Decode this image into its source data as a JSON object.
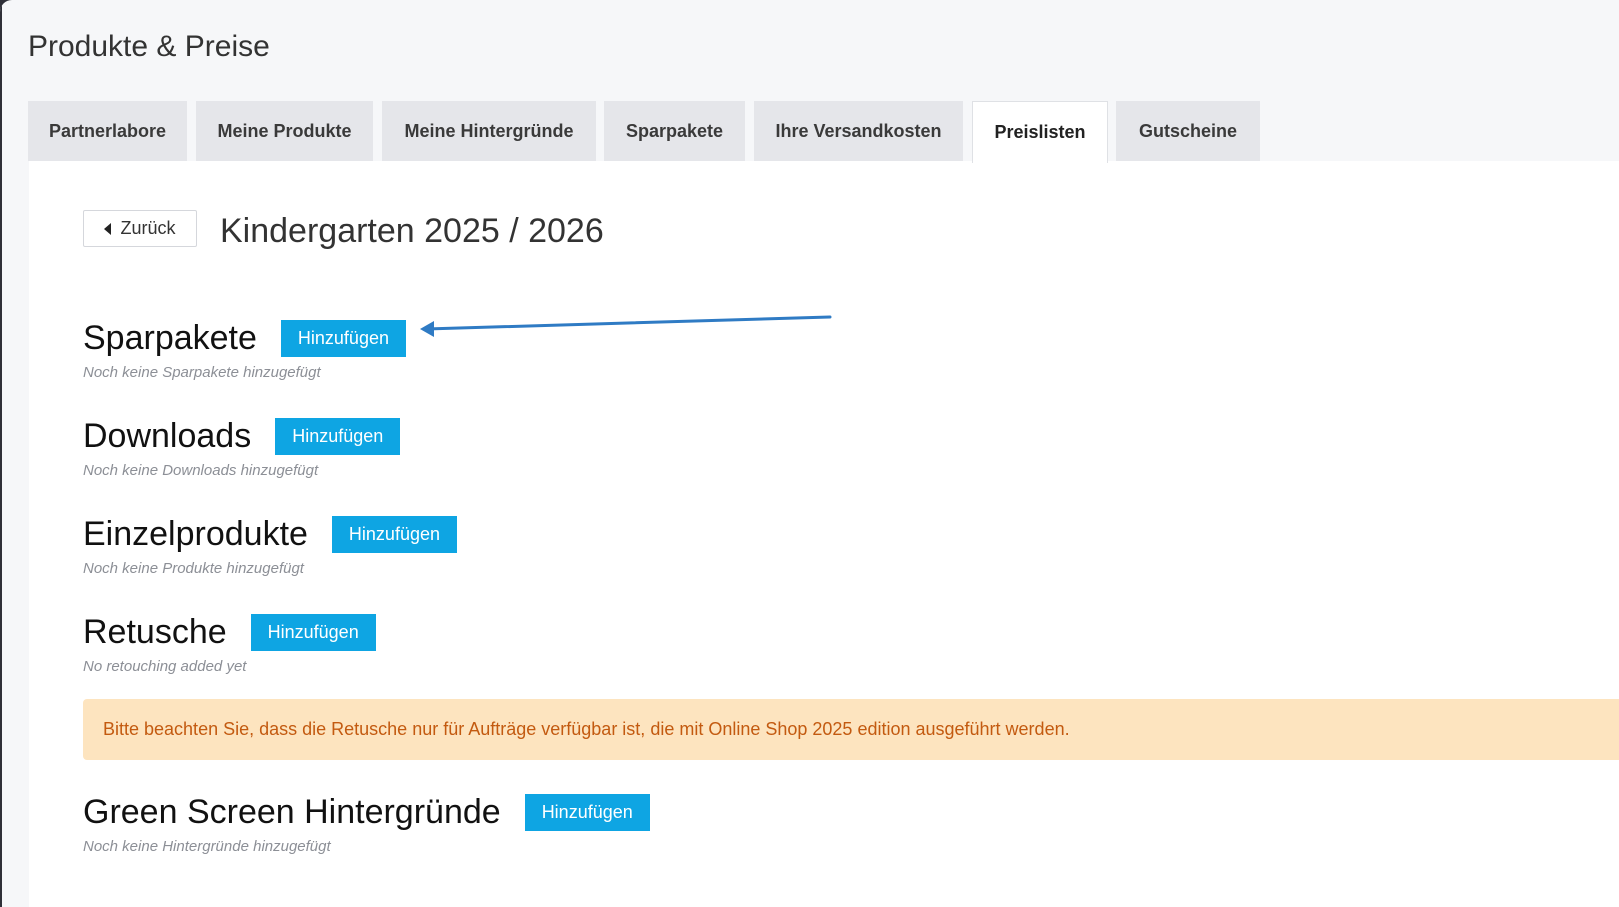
{
  "page": {
    "title": "Produkte & Preise"
  },
  "tabs": [
    {
      "label": "Partnerlabore"
    },
    {
      "label": "Meine Produkte"
    },
    {
      "label": "Meine Hintergründe"
    },
    {
      "label": "Sparpakete"
    },
    {
      "label": "Ihre Versandkosten"
    },
    {
      "label": "Preislisten",
      "active": true
    },
    {
      "label": "Gutscheine"
    }
  ],
  "detail": {
    "back_label": "Zurück",
    "title": "Kindergarten 2025 / 2026"
  },
  "sections": [
    {
      "title": "Sparpakete",
      "button": "Hinzufügen",
      "empty": "Noch keine Sparpakete hinzugefügt"
    },
    {
      "title": "Downloads",
      "button": "Hinzufügen",
      "empty": "Noch keine Downloads hinzugefügt"
    },
    {
      "title": "Einzelprodukte",
      "button": "Hinzufügen",
      "empty": "Noch keine Produkte hinzugefügt"
    },
    {
      "title": "Retusche",
      "button": "Hinzufügen",
      "empty": "No retouching added yet"
    },
    {
      "title": "Green Screen Hintergründe",
      "button": "Hinzufügen",
      "empty": "Noch keine Hintergründe hinzugefügt"
    }
  ],
  "notice": {
    "text": "Bitte beachten Sie, dass die Retusche nur für Aufträge verfügbar ist, die mit Online Shop 2025 edition ausgeführt werden."
  },
  "colors": {
    "accent": "#0ea5e3",
    "notice_bg": "#fde4bf",
    "notice_text": "#c35a10",
    "annotation_arrow": "#2f7bc4"
  }
}
